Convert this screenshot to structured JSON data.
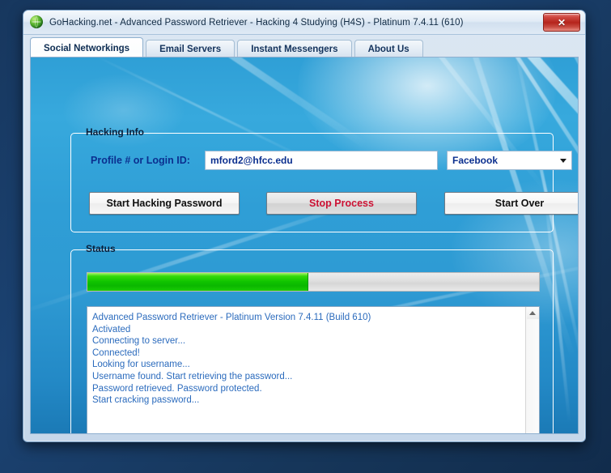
{
  "window": {
    "title": "GoHacking.net - Advanced Password Retriever - Hacking 4 Studying (H4S) - Platinum 7.4.11 (610)",
    "icon": "globe-icon",
    "close_label": "✕",
    "accent_blue": "#2f9fd6",
    "titlebar_color": "#e2ecf6",
    "close_button_color": "#b5241c"
  },
  "tabs": [
    {
      "label": "Social Networkings",
      "active": true
    },
    {
      "label": "Email Servers",
      "active": false
    },
    {
      "label": "Instant Messengers",
      "active": false
    },
    {
      "label": "About Us",
      "active": false
    }
  ],
  "hacking_info": {
    "group_label": "Hacking Info",
    "login_label": "Profile # or Login ID:",
    "login_value": "mford2@hfcc.edu",
    "login_placeholder": "",
    "site_selected": "Facebook",
    "site_options": [
      "Facebook"
    ],
    "label_color": "#0b2f8f"
  },
  "buttons": {
    "start_hacking": "Start Hacking Password",
    "stop_process": "Stop Process",
    "start_over": "Start Over",
    "stop_process_color": "#cc1133"
  },
  "status": {
    "group_label": "Status",
    "progress_percent": 49,
    "progress_color": "#10c400",
    "log_text_color": "#2b6bbd",
    "log_lines": [
      "Advanced Password Retriever - Platinum Version 7.4.11 (Build 610)",
      "Activated",
      "Connecting to server...",
      "Connected!",
      "Looking for username...",
      "Username found. Start retrieving the password...",
      "Password retrieved. Password protected.",
      "Start cracking password..."
    ],
    "scrollbar": {
      "up_icon": "chevron-up-icon",
      "down_icon": "chevron-down-icon"
    }
  }
}
